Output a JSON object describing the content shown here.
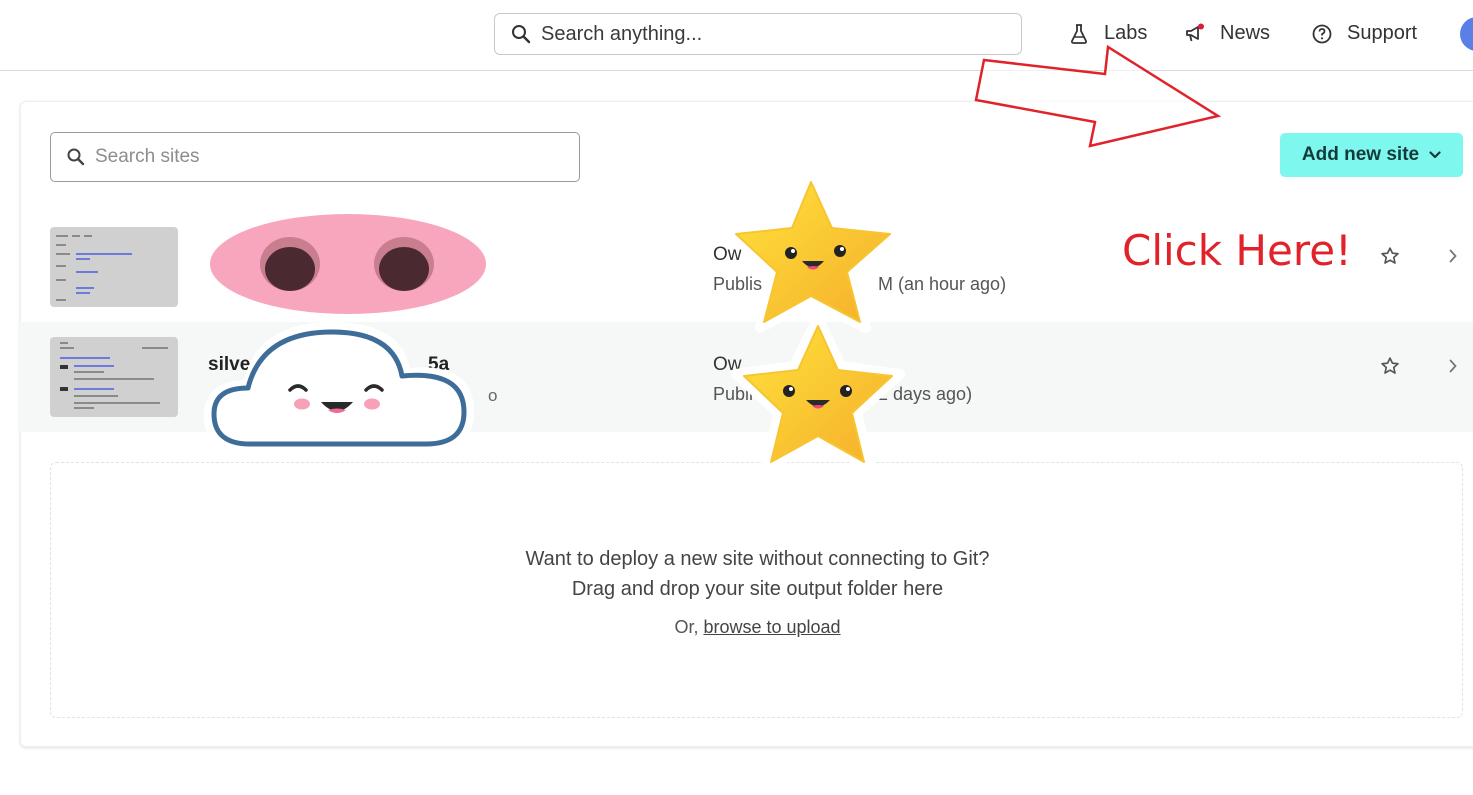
{
  "header": {
    "search_placeholder": "Search anything...",
    "nav": [
      {
        "label": "Labs",
        "icon": "flask-icon"
      },
      {
        "label": "News",
        "icon": "megaphone-icon"
      },
      {
        "label": "Support",
        "icon": "help-circle-icon"
      }
    ]
  },
  "sites": {
    "search_placeholder": "Search sites",
    "add_button_label": "Add new site",
    "rows": [
      {
        "name": "",
        "sub": "",
        "owner": "Ow",
        "published": "Publis",
        "published_time": "M (an hour ago)"
      },
      {
        "name": "silver",
        "name_tail": "5a",
        "sub": "",
        "sub_tail": "o",
        "owner": "Ow",
        "published": "Publi",
        "published_time": "2 days ago)"
      }
    ]
  },
  "dropzone": {
    "line1": "Want to deploy a new site without connecting to Git?",
    "line2": "Drag and drop your site output folder here",
    "or_text": "Or, ",
    "browse_link": "browse to upload"
  },
  "annotation": {
    "click_here": "Click Here!"
  },
  "colors": {
    "accent_button": "#7ef7ee",
    "annotation_red": "#e1222a",
    "notification_dot": "#d81e3a"
  }
}
